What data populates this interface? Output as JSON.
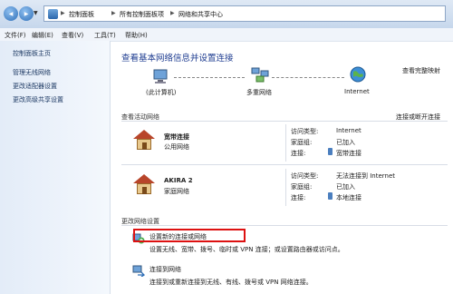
{
  "address": {
    "back_glyph": "◀",
    "forward_glyph": "▶",
    "separator": "▶",
    "breadcrumbs": [
      "控制面板",
      "所有控制面板项",
      "网络和共享中心"
    ]
  },
  "menu": [
    "文件(F)",
    "编辑(E)",
    "查看(V)",
    "工具(T)",
    "帮助(H)"
  ],
  "sidebar": {
    "home": "控制面板主页",
    "links": [
      "管理无线网络",
      "更改适配器设置",
      "更改高级共享设置"
    ]
  },
  "main": {
    "title": "查看基本网络信息并设置连接",
    "full_map_link": "查看完整映射",
    "map_nodes": [
      "(此计算机)",
      "多重网络",
      "Internet"
    ],
    "active_header": "查看活动网络",
    "connect_disconnect_link": "连接或断开连接",
    "networks": [
      {
        "name": "宽带连接",
        "type": "公用网络",
        "rows": [
          {
            "label": "访问类型:",
            "value": "Internet"
          },
          {
            "label": "家庭组:",
            "value": "已加入"
          },
          {
            "label": "连接:",
            "value": "宽带连接"
          }
        ]
      },
      {
        "name": "AKIRA 2",
        "type": "家庭网络",
        "rows": [
          {
            "label": "访问类型:",
            "value": "无法连接到 Internet"
          },
          {
            "label": "家庭组:",
            "value": "已加入"
          },
          {
            "label": "连接:",
            "value": "本地连接"
          }
        ]
      }
    ],
    "change_header": "更改网络设置",
    "tasks": [
      {
        "title": "设置新的连接或网络",
        "desc": "设置无线、宽带、拨号、临时或 VPN 连接；或设置路由器或访问点。"
      },
      {
        "title": "连接到网络",
        "desc": "连接到或重新连接到无线、有线、拨号或 VPN 网络连接。"
      }
    ]
  },
  "colors": {
    "link": "#1a55c8",
    "title": "#1e3c90",
    "highlight_box": "#d11111"
  }
}
